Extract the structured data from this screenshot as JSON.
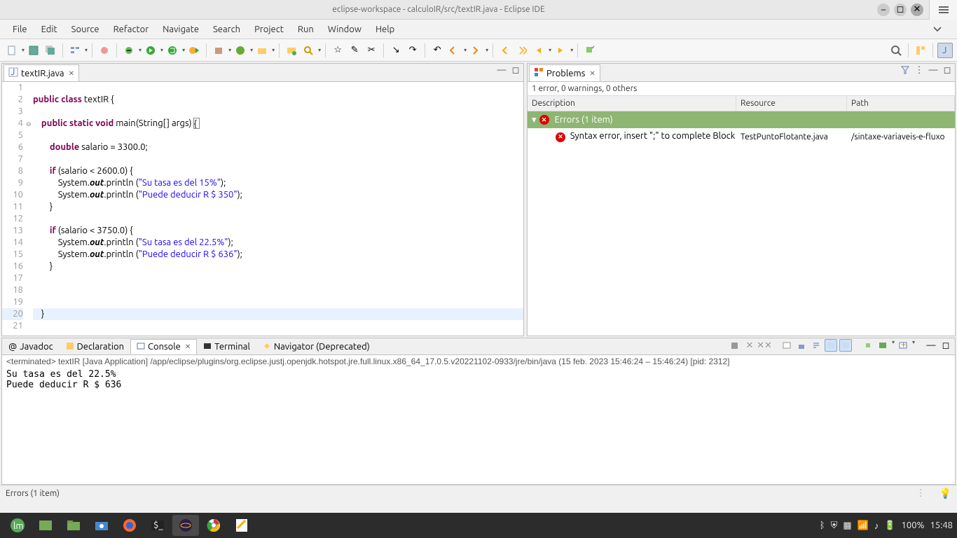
{
  "window": {
    "title": "eclipse-workspace - calculoIR/src/textIR.java - Eclipse IDE"
  },
  "menubar": [
    "File",
    "Edit",
    "Source",
    "Refactor",
    "Navigate",
    "Search",
    "Project",
    "Run",
    "Window",
    "Help"
  ],
  "editor": {
    "tab": {
      "label": "textIR.java"
    },
    "lines": [
      {
        "n": 1,
        "text": ""
      },
      {
        "n": 2,
        "text": "public class textIR {",
        "tokens": [
          [
            "kw",
            "public"
          ],
          [
            "sp",
            " "
          ],
          [
            "kw",
            "class"
          ],
          [
            "sp",
            " "
          ],
          [
            "id",
            "textIR"
          ],
          [
            "sp",
            " "
          ],
          [
            "p",
            "{"
          ]
        ]
      },
      {
        "n": 3,
        "text": ""
      },
      {
        "n": 4,
        "fold": true,
        "text": "    public static void main(String[] args) {",
        "tokens": [
          [
            "sp",
            "    "
          ],
          [
            "kw",
            "public"
          ],
          [
            "sp",
            " "
          ],
          [
            "kw",
            "static"
          ],
          [
            "sp",
            " "
          ],
          [
            "kw",
            "void"
          ],
          [
            "sp",
            " "
          ],
          [
            "id",
            "main"
          ],
          [
            "p",
            "("
          ],
          [
            "id",
            "String"
          ],
          [
            "p",
            "[]"
          ],
          [
            "sp",
            " "
          ],
          [
            "id",
            "args"
          ],
          [
            "p",
            ")"
          ],
          [
            "sp",
            " "
          ],
          [
            "caret",
            ""
          ]
        ]
      },
      {
        "n": 5,
        "text": ""
      },
      {
        "n": 6,
        "text": "        double salario = 3300.0;",
        "tokens": [
          [
            "sp",
            "        "
          ],
          [
            "kw",
            "double"
          ],
          [
            "sp",
            " "
          ],
          [
            "id",
            "salario"
          ],
          [
            "sp",
            " "
          ],
          [
            "p",
            "="
          ],
          [
            "sp",
            " "
          ],
          [
            "num",
            "3300.0"
          ],
          [
            "p",
            ";"
          ]
        ]
      },
      {
        "n": 7,
        "text": ""
      },
      {
        "n": 8,
        "text": "        if (salario < 2600.0) {",
        "tokens": [
          [
            "sp",
            "        "
          ],
          [
            "kw",
            "if"
          ],
          [
            "sp",
            " "
          ],
          [
            "p",
            "("
          ],
          [
            "id",
            "salario"
          ],
          [
            "sp",
            " "
          ],
          [
            "p",
            "<"
          ],
          [
            "sp",
            " "
          ],
          [
            "num",
            "2600.0"
          ],
          [
            "p",
            ")"
          ],
          [
            "sp",
            " "
          ],
          [
            "p",
            "{"
          ]
        ]
      },
      {
        "n": 9,
        "text": "            System.out.println (\"Su tasa es del 15%\");",
        "tokens": [
          [
            "sp",
            "            "
          ],
          [
            "id",
            "System"
          ],
          [
            "p",
            "."
          ],
          [
            "field",
            "out"
          ],
          [
            "p",
            "."
          ],
          [
            "id",
            "println"
          ],
          [
            "sp",
            " "
          ],
          [
            "p",
            "("
          ],
          [
            "str",
            "\"Su tasa es del 15%\""
          ],
          [
            "p",
            ")"
          ],
          [
            "p",
            ";"
          ]
        ]
      },
      {
        "n": 10,
        "text": "            System.out.println (\"Puede deducir R $ 350\");",
        "tokens": [
          [
            "sp",
            "            "
          ],
          [
            "id",
            "System"
          ],
          [
            "p",
            "."
          ],
          [
            "field",
            "out"
          ],
          [
            "p",
            "."
          ],
          [
            "id",
            "println"
          ],
          [
            "sp",
            " "
          ],
          [
            "p",
            "("
          ],
          [
            "str",
            "\"Puede deducir R $ 350\""
          ],
          [
            "p",
            ")"
          ],
          [
            "p",
            ";"
          ]
        ]
      },
      {
        "n": 11,
        "text": "        }",
        "tokens": [
          [
            "sp",
            "        "
          ],
          [
            "p",
            "}"
          ]
        ]
      },
      {
        "n": 12,
        "text": ""
      },
      {
        "n": 13,
        "text": "        if (salario < 3750.0) {",
        "tokens": [
          [
            "sp",
            "        "
          ],
          [
            "kw",
            "if"
          ],
          [
            "sp",
            " "
          ],
          [
            "p",
            "("
          ],
          [
            "id",
            "salario"
          ],
          [
            "sp",
            " "
          ],
          [
            "p",
            "<"
          ],
          [
            "sp",
            " "
          ],
          [
            "num",
            "3750.0"
          ],
          [
            "p",
            ")"
          ],
          [
            "sp",
            " "
          ],
          [
            "p",
            "{"
          ]
        ]
      },
      {
        "n": 14,
        "text": "            System.out.println (\"Su tasa es del 22.5%\");",
        "tokens": [
          [
            "sp",
            "            "
          ],
          [
            "id",
            "System"
          ],
          [
            "p",
            "."
          ],
          [
            "field",
            "out"
          ],
          [
            "p",
            "."
          ],
          [
            "id",
            "println"
          ],
          [
            "sp",
            " "
          ],
          [
            "p",
            "("
          ],
          [
            "str",
            "\"Su tasa es del 22.5%\""
          ],
          [
            "p",
            ")"
          ],
          [
            "p",
            ";"
          ]
        ]
      },
      {
        "n": 15,
        "text": "            System.out.println (\"Puede deducir R $ 636\");",
        "tokens": [
          [
            "sp",
            "            "
          ],
          [
            "id",
            "System"
          ],
          [
            "p",
            "."
          ],
          [
            "field",
            "out"
          ],
          [
            "p",
            "."
          ],
          [
            "id",
            "println"
          ],
          [
            "sp",
            " "
          ],
          [
            "p",
            "("
          ],
          [
            "str",
            "\"Puede deducir R $ 636\""
          ],
          [
            "p",
            ")"
          ],
          [
            "p",
            ";"
          ]
        ]
      },
      {
        "n": 16,
        "text": "        }",
        "tokens": [
          [
            "sp",
            "        "
          ],
          [
            "p",
            "}"
          ]
        ]
      },
      {
        "n": 17,
        "text": ""
      },
      {
        "n": 18,
        "text": ""
      },
      {
        "n": 19,
        "text": ""
      },
      {
        "n": 20,
        "current": true,
        "text": "    }",
        "tokens": [
          [
            "sp",
            "    "
          ],
          [
            "p",
            "}"
          ]
        ]
      },
      {
        "n": 21,
        "text": ""
      }
    ]
  },
  "problems": {
    "tab": "Problems",
    "summary": "1 error, 0 warnings, 0 others",
    "columns": {
      "desc": "Description",
      "res": "Resource",
      "path": "Path"
    },
    "group": "Errors (1 item)",
    "items": [
      {
        "desc": "Syntax error, insert \";\" to complete Block",
        "res": "TestPuntoFlotante.java",
        "path": "/sintaxe-variaveis-e-fluxo"
      }
    ]
  },
  "bottom": {
    "tabs": [
      {
        "label": "Javadoc",
        "icon": "at-icon"
      },
      {
        "label": "Declaration",
        "icon": "decl-icon"
      },
      {
        "label": "Console",
        "icon": "console-icon",
        "active": true,
        "closeable": true
      },
      {
        "label": "Terminal",
        "icon": "terminal-icon"
      },
      {
        "label": "Navigator (Deprecated)",
        "icon": "navigator-icon"
      }
    ],
    "console_header": "<terminated> textIR [Java Application] /app/eclipse/plugins/org.eclipse.justj.openjdk.hotspot.jre.full.linux.x86_64_17.0.5.v20221102-0933/jre/bin/java (15 feb. 2023 15:46:24 – 15:46:24) [pid: 2312]",
    "console_out": "Su tasa es del 22.5%\nPuede deducir R $ 636"
  },
  "statusbar": {
    "text": "Errors (1 item)"
  },
  "taskbar": {
    "battery": "100%",
    "time": "15:48"
  }
}
